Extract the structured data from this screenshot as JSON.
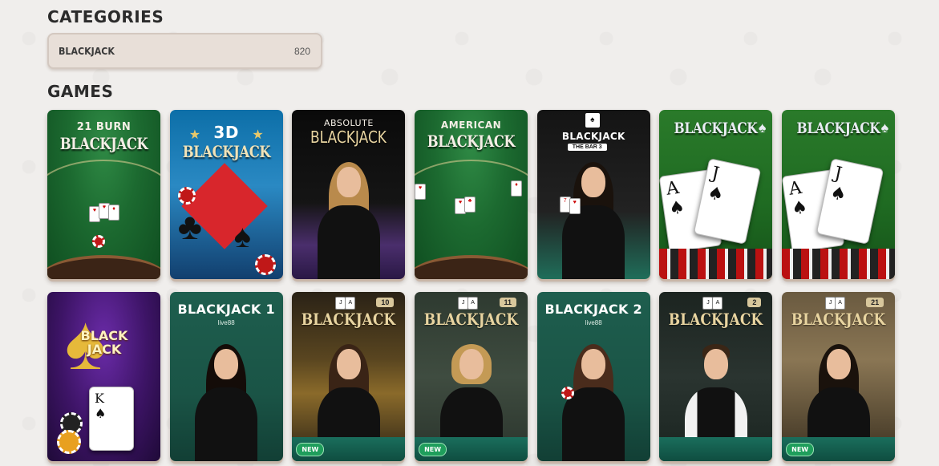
{
  "categories_heading": "CATEGORIES",
  "category": {
    "label": "BLACKJACK",
    "count": "820"
  },
  "games_heading": "GAMES",
  "games": [
    {
      "title": "BLACKJACK",
      "subtitle": "21 BURN"
    },
    {
      "title": "BLACKJACK",
      "subtitle": "3D"
    },
    {
      "title": "BLACKJACK",
      "subtitle": "ABSOLUTE"
    },
    {
      "title": "BLACKJACK",
      "subtitle": "AMERICAN"
    },
    {
      "title": "BLACKJACK",
      "subtitle": "THE BAR 3"
    },
    {
      "title": "BLACKJACK"
    },
    {
      "title": "BLACKJACK"
    },
    {
      "title": "BLACK JACK"
    },
    {
      "title": "BLACKJACK 1",
      "provider": "live88"
    },
    {
      "title": "BLACKJACK",
      "table_number": "10",
      "badge": "NEW"
    },
    {
      "title": "BLACKJACK",
      "table_number": "11",
      "badge": "NEW"
    },
    {
      "title": "BLACKJACK 2",
      "provider": "live88"
    },
    {
      "title": "BLACKJACK",
      "table_number": "2"
    },
    {
      "title": "BLACKJACK",
      "table_number": "21",
      "badge": "NEW"
    }
  ],
  "colors": {
    "page_bg": "#f0eeec",
    "pill_bg": "#e8dfd8",
    "felt_green": "#1c6a30",
    "new_badge": "#1f9e5c"
  }
}
